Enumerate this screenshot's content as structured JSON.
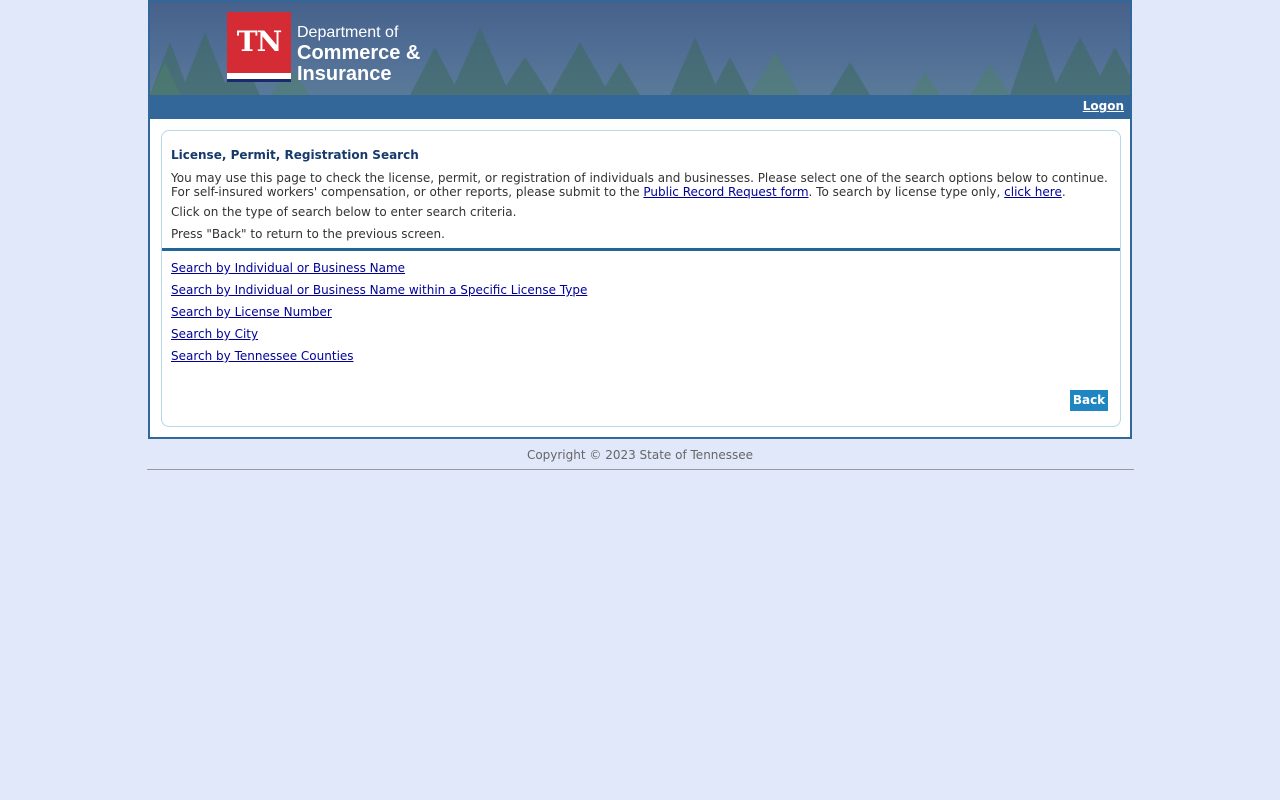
{
  "header": {
    "logo": {
      "badge_text": "TN",
      "line1": "Department of",
      "line2": "Commerce &",
      "line3": "Insurance"
    },
    "logon_label": "Logon"
  },
  "main": {
    "title": "License, Permit, Registration Search",
    "intro": {
      "part1": "You may use this page to check the license, permit, or registration of individuals and businesses. Please select one of the search options below to continue. For self-insured workers' compensation, or other reports, please submit to the ",
      "public_record_link": "Public Record Request form",
      "part2": ". To search by license type only, ",
      "click_here_link": "click here",
      "part3": "."
    },
    "click_on_text": "Click on the type of search below to enter search criteria.",
    "press_back_text": "Press \"Back\" to return to the previous screen.",
    "search_links": [
      "Search by Individual or Business Name",
      "Search by Individual or Business Name within a Specific License Type",
      "Search by License Number",
      "Search by City",
      "Search by Tennessee Counties"
    ],
    "back_label": "Back"
  },
  "footer": {
    "copyright": "Copyright © 2023 State of Tennessee"
  },
  "colors": {
    "page_background": "#e0e8fa",
    "nav_bar": "#336699",
    "logo_red": "#d52b34",
    "link": "#000099",
    "button": "#1f86c1",
    "title": "#153a6b"
  }
}
